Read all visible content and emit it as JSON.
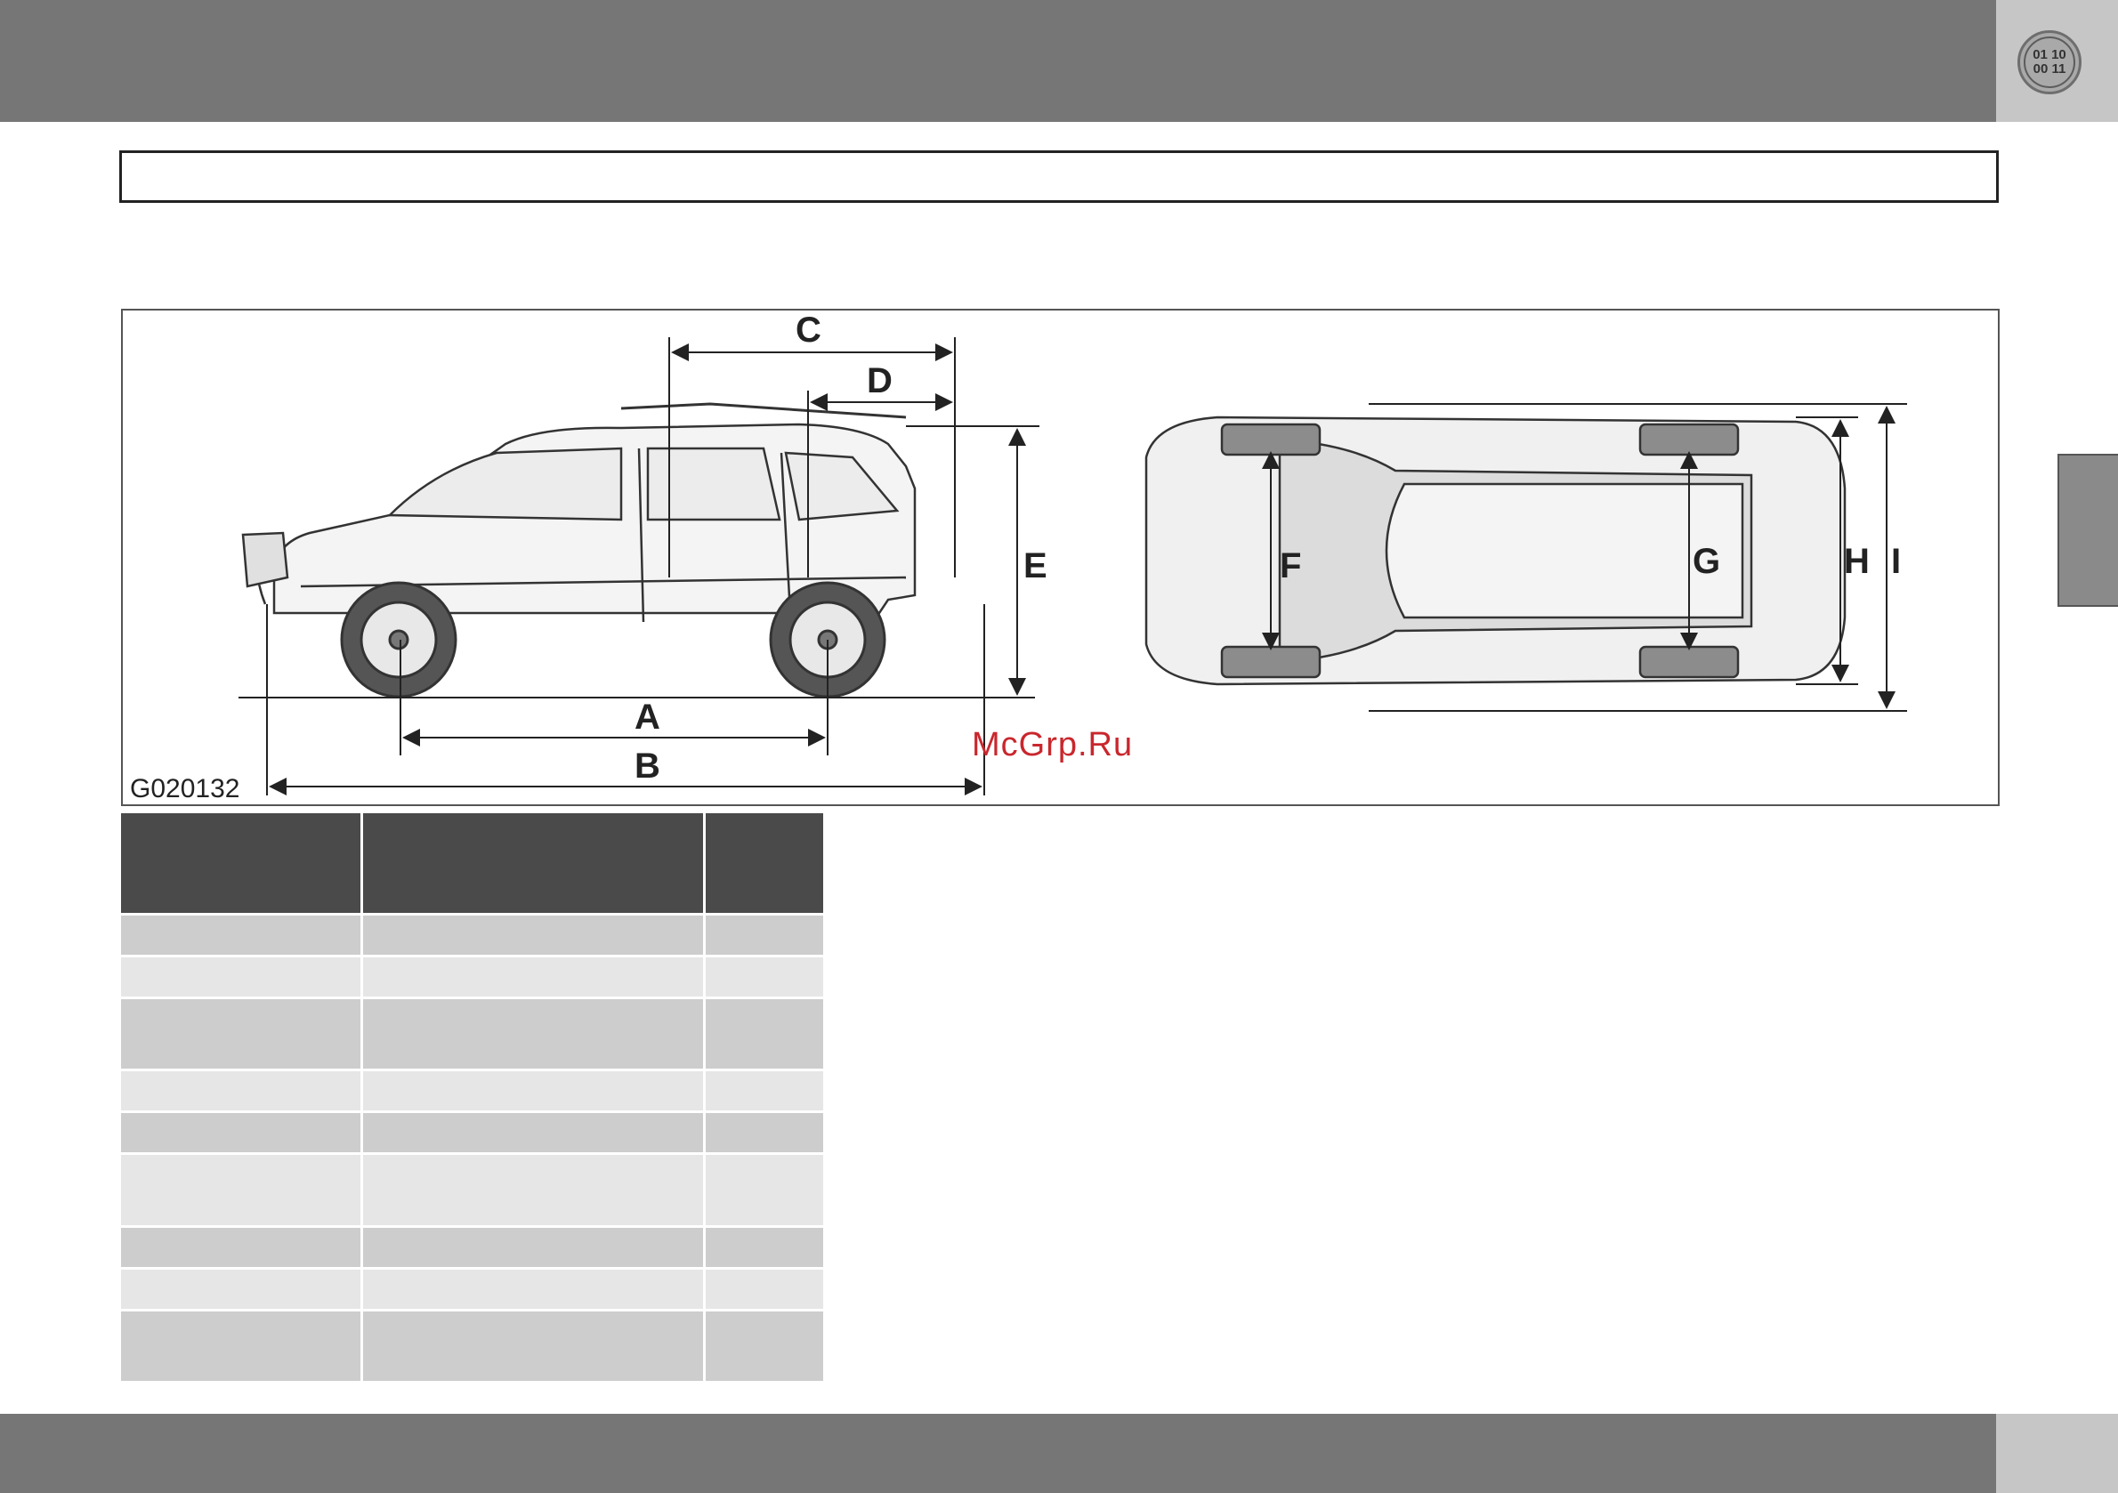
{
  "header": {
    "badge_line1": "01 10",
    "badge_line2": "00 11"
  },
  "figure": {
    "code": "G020132",
    "labels": {
      "a": "A",
      "b": "B",
      "c": "C",
      "d": "D",
      "e": "E",
      "f": "F",
      "g": "G",
      "h": "H",
      "i": "I"
    }
  },
  "watermark": "McGrp.Ru",
  "colors": {
    "bars": "#767676",
    "corner": "#c6c6c6",
    "table_header": "#4a4a4a",
    "row_dark": "#cdcdcd",
    "row_light": "#e6e6e6",
    "watermark": "#c9272d"
  }
}
